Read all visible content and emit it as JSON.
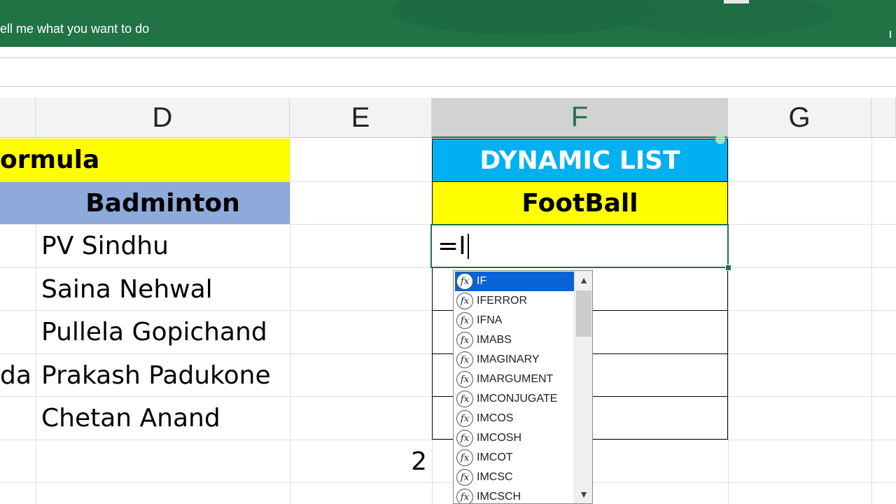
{
  "ribbon": {
    "tell_me": "ell me what you want to do"
  },
  "columns": [
    "D",
    "E",
    "F",
    "G"
  ],
  "cells": {
    "c_row1": "ormula",
    "d_row2": "Badminton",
    "c_row6": "da",
    "names": [
      "PV Sindhu",
      "Saina Nehwal",
      "Pullela Gopichand",
      "Prakash Padukone",
      "Chetan Anand"
    ],
    "e_row8": "2",
    "f_row1": "DYNAMIC LIST",
    "f_row2": "FootBall"
  },
  "formula_input": "=I",
  "autocomplete": {
    "items": [
      "IF",
      "IFERROR",
      "IFNA",
      "IMABS",
      "IMAGINARY",
      "IMARGUMENT",
      "IMCONJUGATE",
      "IMCOS",
      "IMCOSH",
      "IMCOT",
      "IMCSC",
      "IMCSCH"
    ],
    "selected": "IF",
    "fx_glyph": "fx",
    "scroll_up": "▲",
    "scroll_down": "▼"
  },
  "colors": {
    "ribbon": "#217346",
    "yellow": "#ffff00",
    "header_blue": "#8eaadb",
    "cyan": "#00b0f0",
    "selection": "#0a63d6"
  },
  "icons": [
    "fx-icon",
    "scroll-up-arrow-icon",
    "scroll-down-arrow-icon"
  ]
}
